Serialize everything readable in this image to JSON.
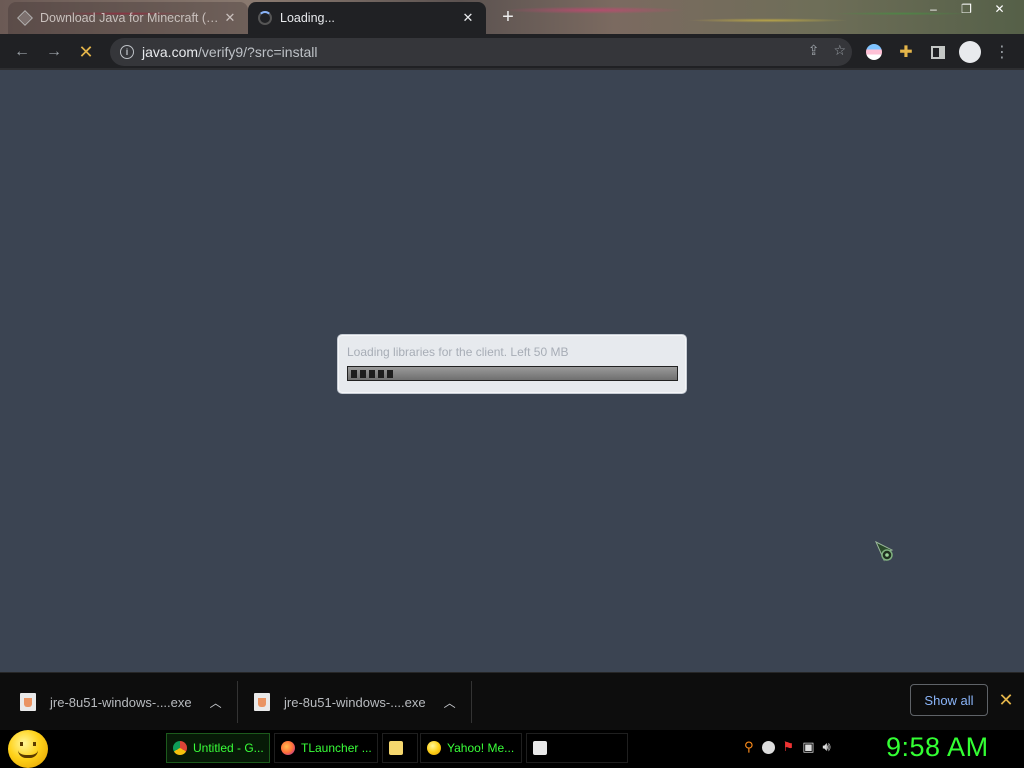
{
  "tabs": [
    {
      "title": "Download Java for Minecraft (Re...",
      "active": false,
      "close_icon": "close-icon"
    },
    {
      "title": "Loading...",
      "active": true,
      "close_icon": "close-icon"
    }
  ],
  "window_controls": {
    "minimize": "–",
    "restore": "❐",
    "close": "✕"
  },
  "toolbar": {
    "back_icon": "arrow-left-icon",
    "forward_icon": "arrow-right-icon",
    "stop_icon": "close-icon",
    "url_host": "java.com",
    "url_path": "/verify9/?src=install",
    "share_icon": "share-icon",
    "bookmark_icon": "star-icon",
    "extensions_icon": "puzzle-icon",
    "profile_icon": "avatar-icon",
    "menu_icon": "kebab-menu-icon"
  },
  "loader": {
    "message": "Loading libraries for the client. Left 50 MB",
    "progress_segments": 5
  },
  "downloads": {
    "items": [
      {
        "name": "jre-8u51-windows-....exe"
      },
      {
        "name": "jre-8u51-windows-....exe"
      }
    ],
    "show_all_label": "Show all"
  },
  "taskbar": {
    "tasks": [
      {
        "label": "Untitled - G...",
        "icon": "chrome-icon",
        "active": true
      },
      {
        "label": "TLauncher ...",
        "icon": "firefox-icon",
        "active": false
      },
      {
        "label": "",
        "icon": "folder-icon",
        "active": false
      },
      {
        "label": "Yahoo! Me...",
        "icon": "yahoo-messenger-icon",
        "active": false
      },
      {
        "label": "",
        "icon": "java-icon",
        "active": false
      }
    ],
    "clock": "9:58 AM"
  },
  "colors": {
    "content_bg": "#3b4452",
    "clock": "#33ff33",
    "task_text": "#39ff39",
    "show_all": "#8ab4f8"
  }
}
